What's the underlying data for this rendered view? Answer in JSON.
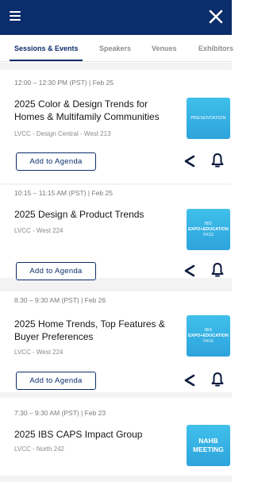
{
  "tabs": [
    {
      "label": "Sessions & Events",
      "active": true
    },
    {
      "label": "Speakers",
      "active": false
    },
    {
      "label": "Venues",
      "active": false
    },
    {
      "label": "Exhibitors",
      "active": false
    }
  ],
  "colors": {
    "nav_bg": "#0c2d6b",
    "badge": "#32aee3",
    "list_bg": "#f3f3f3"
  },
  "icons": {
    "menu": "hamburger-icon",
    "close": "close-icon",
    "share": "share-icon",
    "reminder": "bell-icon"
  },
  "sessions": [
    {
      "time": "12:00 – 12:30 PM (PST) | Feb 25",
      "title": "2025 Color & Design Trends for Homes & Multifamily Communities",
      "location": "LVCC - Design Central - West 213",
      "badge": {
        "line1": "PRESENTATION"
      },
      "add_label": "Add to Agenda"
    },
    {
      "time": "10:15 – 11:15 AM (PST) | Feb 25",
      "title": "2025 Design & Product Trends",
      "location": "LVCC - West 224",
      "badge": {
        "line1": "IBS",
        "line2": "EXPO+EDUCATION",
        "line3": "PASS"
      },
      "add_label": "Add to Agenda"
    },
    {
      "time": "8:30 – 9:30 AM (PST) | Feb 26",
      "title": "2025 Home Trends, Top Features & Buyer Preferences",
      "location": "LVCC - West 224",
      "badge": {
        "line1": "IBS",
        "line2": "EXPO+EDUCATION",
        "line3": "PASS"
      },
      "add_label": "Add to Agenda"
    },
    {
      "time": "7:30 – 9:30 AM (PST) | Feb 23",
      "title": "2025 IBS CAPS Impact Group",
      "location": "LVCC - North 242",
      "badge": {
        "line1": "NAHB",
        "line2": "MEETING"
      }
    }
  ]
}
